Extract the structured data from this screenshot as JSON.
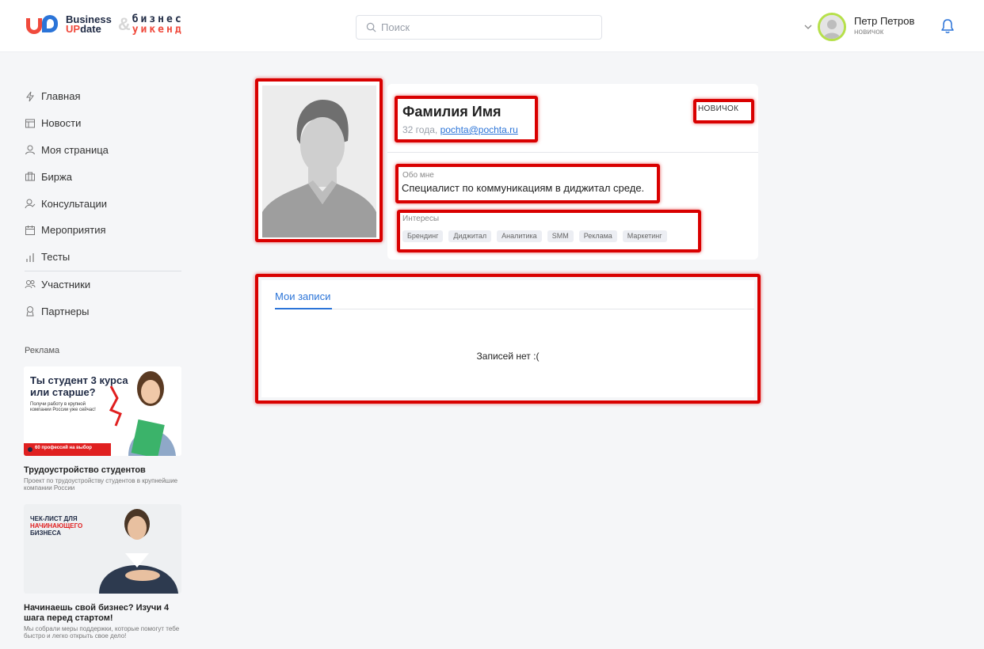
{
  "header": {
    "logo": {
      "en_line1": "Business",
      "en_line2_prefix": "UP",
      "en_line2_suffix": "date",
      "ampersand": "&",
      "ru_line1": "бизнес",
      "ru_line2": "уикенд"
    },
    "search": {
      "placeholder": "Поиск",
      "value": ""
    },
    "user": {
      "name": "Петр Петров",
      "role": "новичок"
    }
  },
  "sidebar": {
    "items": [
      {
        "label": "Главная",
        "icon": "bolt-icon"
      },
      {
        "label": "Новости",
        "icon": "news-icon"
      },
      {
        "label": "Моя страница",
        "icon": "user-icon"
      },
      {
        "label": "Биржа",
        "icon": "exchange-icon"
      },
      {
        "label": "Консультации",
        "icon": "consult-icon"
      },
      {
        "label": "Мероприятия",
        "icon": "calendar-icon"
      },
      {
        "label": "Тесты",
        "icon": "bar-chart-icon"
      },
      {
        "label": "Участники",
        "icon": "users-icon"
      },
      {
        "label": "Партнеры",
        "icon": "partner-icon"
      }
    ],
    "ads_label": "Реклама",
    "ads": [
      {
        "banner_title": "Ты студент 3 курса или старше?",
        "banner_sub": "Получи работу в крупной компании России уже сейчас!",
        "banner_strip": "60 профессий на выбор",
        "title": "Трудоустройство студентов",
        "desc": "Проект по трудоустройству студентов в крупнейшие компании России"
      },
      {
        "banner_line1": "ЧЕК-ЛИСТ ДЛЯ",
        "banner_line2": "НАЧИНАЮЩЕГО",
        "banner_line3": "БИЗНЕСА",
        "title": "Начинаешь свой бизнес? Изучи 4 шага перед стартом!",
        "desc": "Мы собрали меры поддержки, которые помогут тебе быстро и легко открыть свое дело!"
      }
    ]
  },
  "profile": {
    "name": "Фамилия Имя",
    "age": "32 года,",
    "email": "pochta@pochta.ru",
    "badge": "НОВИЧОК",
    "about_label": "Обо мне",
    "about_text": "Специалист по коммуникациям в диджитал среде.",
    "interests_label": "Интересы",
    "interests": [
      "Брендинг",
      "Диджитал",
      "Аналитика",
      "SMM",
      "Реклама",
      "Маркетинг"
    ]
  },
  "posts": {
    "tab_label": "Мои записи",
    "empty_text": "Записей нет :("
  },
  "colors": {
    "accent": "#2b74d8",
    "brand_red": "#f04a3c",
    "highlight": "#d90000"
  }
}
